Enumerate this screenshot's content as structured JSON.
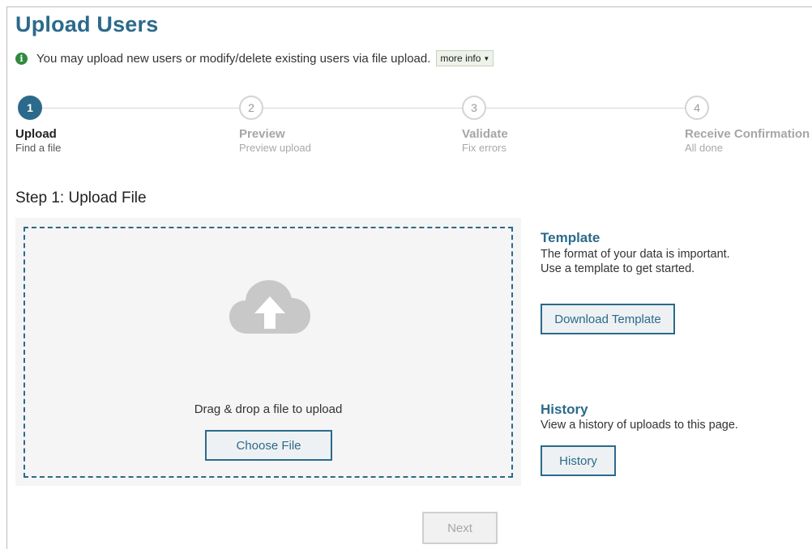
{
  "page": {
    "title": "Upload Users",
    "info_text": "You may upload new users or modify/delete existing users via file upload.",
    "more_info_label": "more info",
    "info_icon": "info-icon"
  },
  "steps": [
    {
      "number": "1",
      "title": "Upload",
      "subtitle": "Find a file",
      "state": "active"
    },
    {
      "number": "2",
      "title": "Preview",
      "subtitle": "Preview upload",
      "state": "inactive"
    },
    {
      "number": "3",
      "title": "Validate",
      "subtitle": "Fix errors",
      "state": "inactive"
    },
    {
      "number": "4",
      "title": "Receive Confirmation",
      "subtitle": "All done",
      "state": "inactive"
    }
  ],
  "upload": {
    "section_title": "Step 1: Upload File",
    "drop_text": "Drag & drop a file to upload",
    "choose_button": "Choose File",
    "icon": "cloud-upload-icon"
  },
  "template": {
    "heading": "Template",
    "description": "The format of your data is important. Use a template to get started.",
    "button": "Download Template"
  },
  "history": {
    "heading": "History",
    "description": "View a history of uploads to this page.",
    "button": "History"
  },
  "footer": {
    "next_button": "Next",
    "next_enabled": false
  },
  "colors": {
    "accent": "#2b6a8b",
    "info_green": "#2f8a3d",
    "disabled": "#a7a7a7"
  }
}
